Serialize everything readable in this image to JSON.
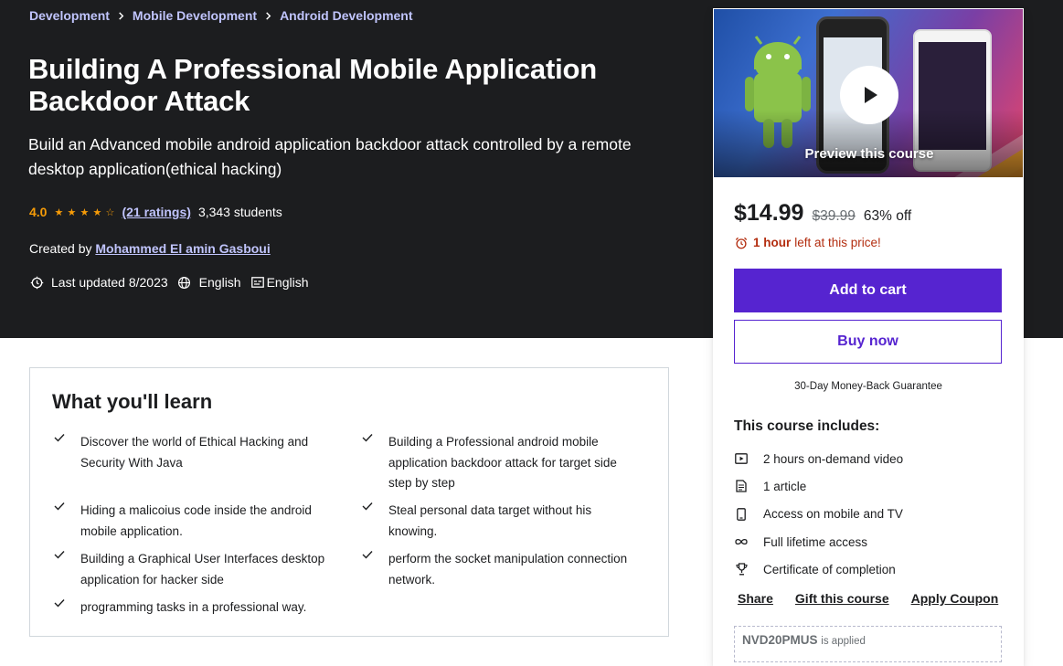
{
  "breadcrumb": [
    "Development",
    "Mobile Development",
    "Android Development"
  ],
  "course": {
    "title": "Building A Professional Mobile Application Backdoor Attack",
    "subtitle": "Build an Advanced mobile android application backdoor attack controlled by a remote desktop application(ethical hacking)",
    "rating": "4.0",
    "stars": 4,
    "ratings_count": "(21 ratings)",
    "students": "3,343 students",
    "created_by_label": "Created by",
    "instructor": "Mohammed El amin Gasboui",
    "last_updated": "Last updated 8/2023",
    "language": "English",
    "captions": "English"
  },
  "preview": {
    "label": "Preview this course"
  },
  "purchase": {
    "price": "$14.99",
    "original_price": "$39.99",
    "discount": "63% off",
    "timer_bold": "1 hour",
    "timer_text": "left at this price!",
    "add_to_cart": "Add to cart",
    "buy_now": "Buy now",
    "guarantee": "30-Day Money-Back Guarantee",
    "includes_title": "This course includes:",
    "includes": [
      {
        "icon": "video-icon",
        "label": "2 hours on-demand video"
      },
      {
        "icon": "article-icon",
        "label": "1 article"
      },
      {
        "icon": "mobile-icon",
        "label": "Access on mobile and TV"
      },
      {
        "icon": "infinity-icon",
        "label": "Full lifetime access"
      },
      {
        "icon": "trophy-icon",
        "label": "Certificate of completion"
      }
    ],
    "share": "Share",
    "gift": "Gift this course",
    "apply_coupon": "Apply Coupon",
    "coupon_code": "NVD20PMUS",
    "coupon_note": "is applied"
  },
  "learn": {
    "title": "What you'll learn",
    "items": [
      "Discover the world of Ethical Hacking and Security With Java",
      "Building a Professional android mobile application backdoor attack for target side step by step",
      "Hiding a malicoius code inside the android mobile application.",
      "Steal personal data target without his knowing.",
      "Building a Graphical User Interfaces desktop application for hacker side",
      "perform the socket manipulation connection network.",
      "programming tasks in a professional way."
    ]
  },
  "colors": {
    "hero_bg": "#1c1d1f",
    "link_purple": "#c0c4fc",
    "star_orange": "#f69c08",
    "brand_purple": "#5624d0",
    "timer_red": "#b32d0f"
  }
}
